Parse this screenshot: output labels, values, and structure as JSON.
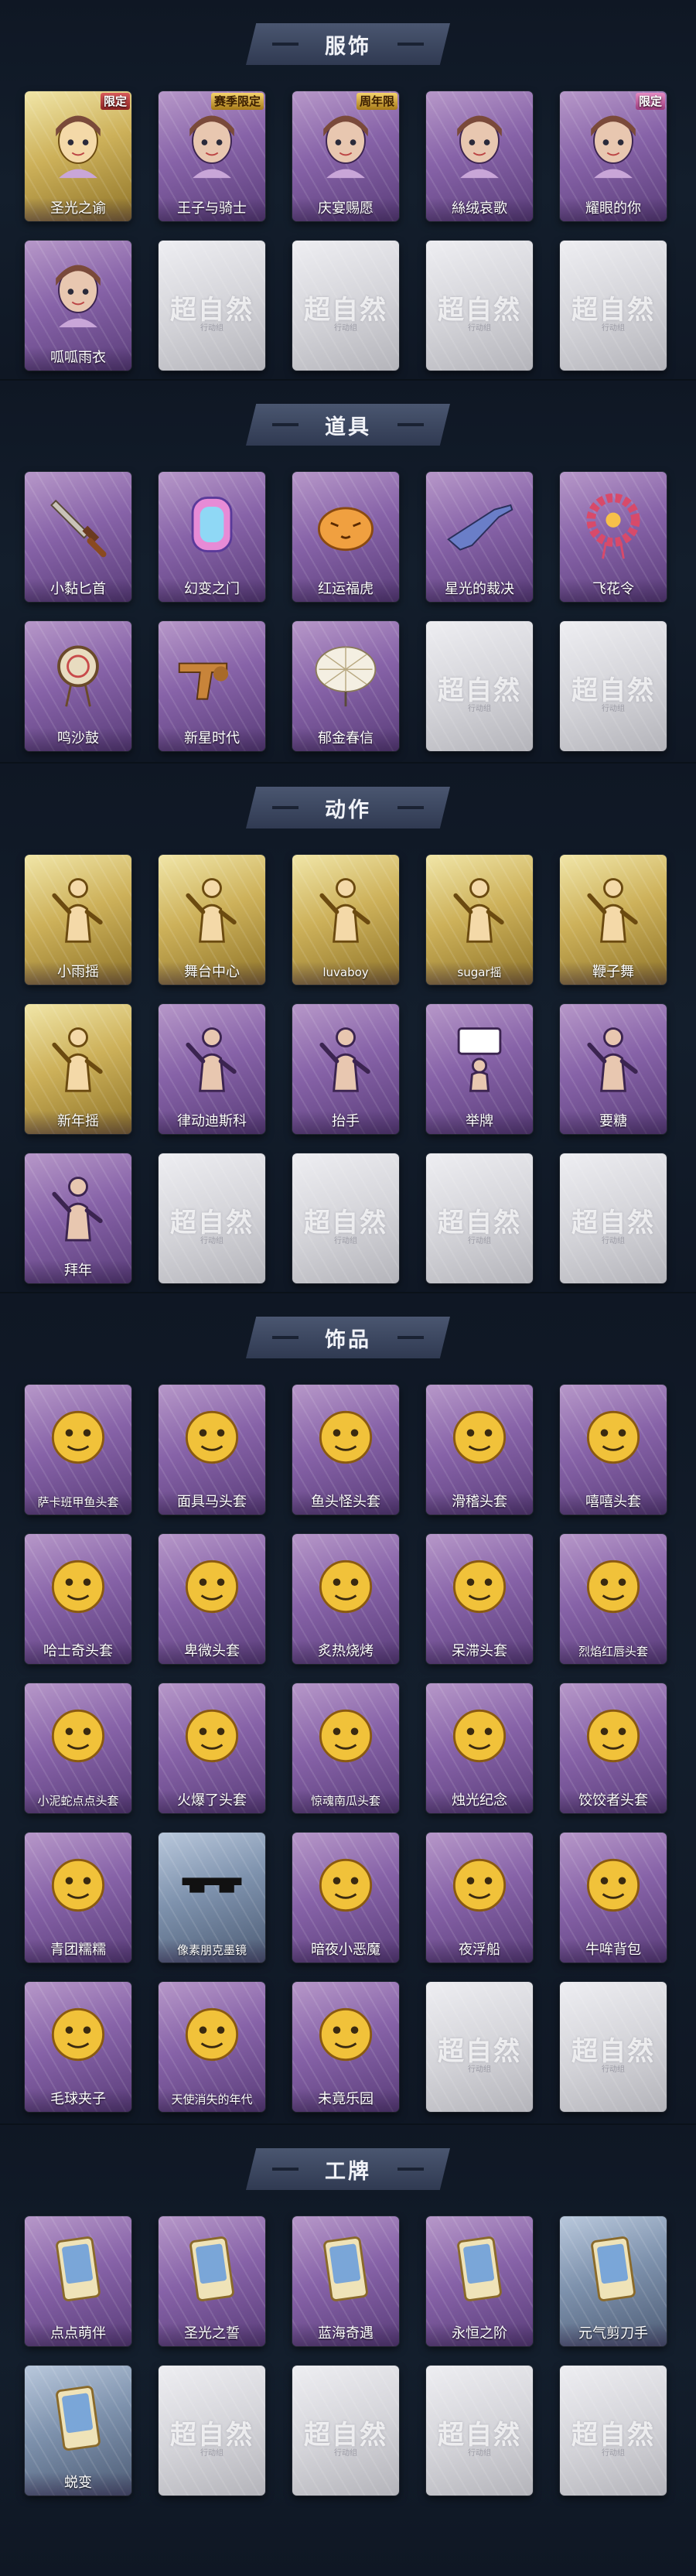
{
  "placeholder": {
    "logo": "超自然",
    "sub": "行动组"
  },
  "colors": {
    "background": "#101a27",
    "banner": "#303a52",
    "card_purple": "#8763a8",
    "card_gold": "#cdb15a",
    "card_blue": "#7e92ad",
    "card_empty": "#d5d5da"
  },
  "sections": [
    {
      "key": "costume",
      "title": "服饰",
      "items": [
        {
          "label": "圣光之谕",
          "rarity": "gold",
          "icon": "portrait-icon",
          "badge": "限定",
          "badge_style": "red"
        },
        {
          "label": "王子与骑士",
          "rarity": "purple",
          "icon": "portrait-icon",
          "badge": "赛季限定",
          "badge_style": "gold"
        },
        {
          "label": "庆宴赐愿",
          "rarity": "purple",
          "icon": "portrait-icon",
          "badge": "周年限",
          "badge_style": "gold"
        },
        {
          "label": "絲绒哀歌",
          "rarity": "purple",
          "icon": "portrait-icon"
        },
        {
          "label": "耀眼的你",
          "rarity": "purple",
          "icon": "portrait-icon",
          "badge": "限定",
          "badge_style": "pink"
        },
        {
          "label": "呱呱雨衣",
          "rarity": "purple",
          "icon": "portrait-icon"
        },
        {
          "empty": true
        },
        {
          "empty": true
        },
        {
          "empty": true
        },
        {
          "empty": true
        }
      ]
    },
    {
      "key": "props",
      "title": "道具",
      "items": [
        {
          "label": "小黏匕首",
          "rarity": "purple",
          "icon": "dagger-icon"
        },
        {
          "label": "幻变之门",
          "rarity": "purple",
          "icon": "gate-icon"
        },
        {
          "label": "红运福虎",
          "rarity": "purple",
          "icon": "tiger-icon"
        },
        {
          "label": "星光的裁决",
          "rarity": "purple",
          "icon": "rifle-icon"
        },
        {
          "label": "飞花令",
          "rarity": "purple",
          "icon": "flower-wreath-icon"
        },
        {
          "label": "鸣沙鼓",
          "rarity": "purple",
          "icon": "drum-icon"
        },
        {
          "label": "新星时代",
          "rarity": "purple",
          "icon": "revolver-icon"
        },
        {
          "label": "郁金春信",
          "rarity": "purple",
          "icon": "umbrella-icon"
        },
        {
          "empty": true
        },
        {
          "empty": true
        }
      ]
    },
    {
      "key": "emotes",
      "title": "动作",
      "items": [
        {
          "label": "小雨摇",
          "rarity": "gold",
          "icon": "pose-icon"
        },
        {
          "label": "舞台中心",
          "rarity": "gold",
          "icon": "pose-icon"
        },
        {
          "label": "luvaboy",
          "rarity": "gold",
          "icon": "pose-icon"
        },
        {
          "label": "sugar摇",
          "rarity": "gold",
          "icon": "pose-icon"
        },
        {
          "label": "鞭子舞",
          "rarity": "gold",
          "icon": "pose-icon"
        },
        {
          "label": "新年摇",
          "rarity": "gold",
          "icon": "pose-icon"
        },
        {
          "label": "律动迪斯科",
          "rarity": "purple",
          "icon": "pose-icon"
        },
        {
          "label": "抬手",
          "rarity": "purple",
          "icon": "pose-icon"
        },
        {
          "label": "举牌",
          "rarity": "purple",
          "icon": "sign-icon"
        },
        {
          "label": "要糖",
          "rarity": "purple",
          "icon": "pose-icon"
        },
        {
          "label": "拜年",
          "rarity": "purple",
          "icon": "pose-icon"
        },
        {
          "empty": true
        },
        {
          "empty": true
        },
        {
          "empty": true
        },
        {
          "empty": true
        }
      ]
    },
    {
      "key": "accessories",
      "title": "饰品",
      "items": [
        {
          "label": "萨卡班甲鱼头套",
          "rarity": "purple",
          "icon": "fish-head-icon"
        },
        {
          "label": "面具马头套",
          "rarity": "purple",
          "icon": "horse-head-icon"
        },
        {
          "label": "鱼头怪头套",
          "rarity": "purple",
          "icon": "fish-monster-icon"
        },
        {
          "label": "滑稽头套",
          "rarity": "purple",
          "icon": "funny-face-icon"
        },
        {
          "label": "嘻嘻头套",
          "rarity": "purple",
          "icon": "grin-face-icon"
        },
        {
          "label": "哈士奇头套",
          "rarity": "purple",
          "icon": "husky-icon"
        },
        {
          "label": "卑微头套",
          "rarity": "purple",
          "icon": "sad-face-icon"
        },
        {
          "label": "炙热烧烤",
          "rarity": "purple",
          "icon": "bbq-icon"
        },
        {
          "label": "呆滞头套",
          "rarity": "purple",
          "icon": "dazed-face-icon"
        },
        {
          "label": "烈焰红唇头套",
          "rarity": "purple",
          "icon": "pikachu-icon"
        },
        {
          "label": "小泥蛇点点头套",
          "rarity": "purple",
          "icon": "snake-icon"
        },
        {
          "label": "火爆了头套",
          "rarity": "purple",
          "icon": "fire-face-icon"
        },
        {
          "label": "惊魂南瓜头套",
          "rarity": "purple",
          "icon": "pumpkin-icon"
        },
        {
          "label": "烛光纪念",
          "rarity": "purple",
          "icon": "candle-icon"
        },
        {
          "label": "饺饺者头套",
          "rarity": "purple",
          "icon": "dumpling-icon"
        },
        {
          "label": "青团糯糯",
          "rarity": "purple",
          "icon": "qingtuan-icon"
        },
        {
          "label": "像素朋克墨镜",
          "rarity": "blue",
          "icon": "pixel-glasses-icon"
        },
        {
          "label": "暗夜小恶魔",
          "rarity": "purple",
          "icon": "devil-icon"
        },
        {
          "label": "夜浮船",
          "rarity": "purple",
          "icon": "ghost-ship-icon"
        },
        {
          "label": "牛哞背包",
          "rarity": "purple",
          "icon": "cow-backpack-icon"
        },
        {
          "label": "毛球夹子",
          "rarity": "purple",
          "icon": "fox-clip-icon"
        },
        {
          "label": "天使消失的年代",
          "rarity": "purple",
          "icon": "angel-icon"
        },
        {
          "label": "未竟乐园",
          "rarity": "purple",
          "icon": "fairy-icon"
        },
        {
          "empty": true
        },
        {
          "empty": true
        }
      ]
    },
    {
      "key": "badges",
      "title": "工牌",
      "items": [
        {
          "label": "点点萌伴",
          "rarity": "purple",
          "icon": "card-icon"
        },
        {
          "label": "圣光之誓",
          "rarity": "purple",
          "icon": "card-icon"
        },
        {
          "label": "蓝海奇遇",
          "rarity": "purple",
          "icon": "card-icon"
        },
        {
          "label": "永恒之阶",
          "rarity": "purple",
          "icon": "card-icon"
        },
        {
          "label": "元气剪刀手",
          "rarity": "blue",
          "icon": "card-icon"
        },
        {
          "label": "蜕变",
          "rarity": "blue",
          "icon": "card-icon"
        },
        {
          "empty": true
        },
        {
          "empty": true
        },
        {
          "empty": true
        },
        {
          "empty": true
        }
      ]
    }
  ]
}
